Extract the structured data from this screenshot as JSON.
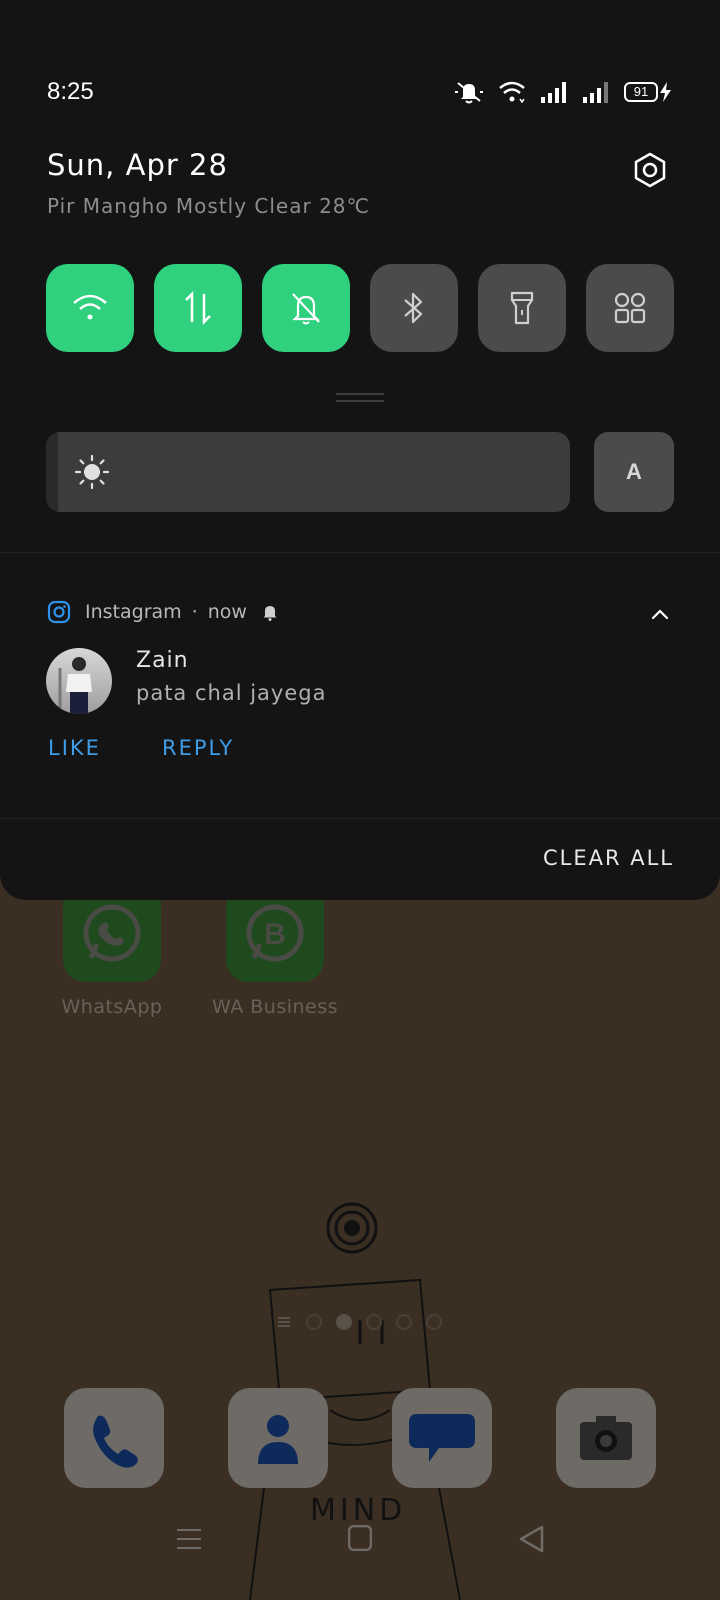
{
  "status_bar": {
    "time": "8:25",
    "battery": "91",
    "icons": [
      "mute-bell-icon",
      "wifi-icon",
      "signal-icon",
      "signal-icon",
      "battery-icon",
      "charging-icon"
    ]
  },
  "header": {
    "date": "Sun, Apr 28",
    "weather": "Pir Mangho Mostly Clear 28℃"
  },
  "quick_tiles": [
    {
      "name": "wifi",
      "on": true
    },
    {
      "name": "mobile-data",
      "on": true
    },
    {
      "name": "silent-mode",
      "on": true
    },
    {
      "name": "bluetooth",
      "on": false
    },
    {
      "name": "flashlight",
      "on": false
    },
    {
      "name": "more-tiles",
      "on": false
    }
  ],
  "brightness": {
    "level": 0.02,
    "auto_label": "A"
  },
  "notification": {
    "app": "Instagram",
    "time": "now",
    "sender": "Zain",
    "message": "pata chal jayega",
    "actions": [
      "LIKE",
      "REPLY"
    ]
  },
  "clear_all_label": "CLEAR ALL",
  "home": {
    "apps": [
      {
        "label": "WhatsApp"
      },
      {
        "label": "WA Business"
      }
    ],
    "pages": 5,
    "current_page": 2,
    "doodle_text": "MIND"
  },
  "colors": {
    "accent_green": "#2fd17e",
    "link_blue": "#3f9de8",
    "shade_bg": "#141414"
  }
}
